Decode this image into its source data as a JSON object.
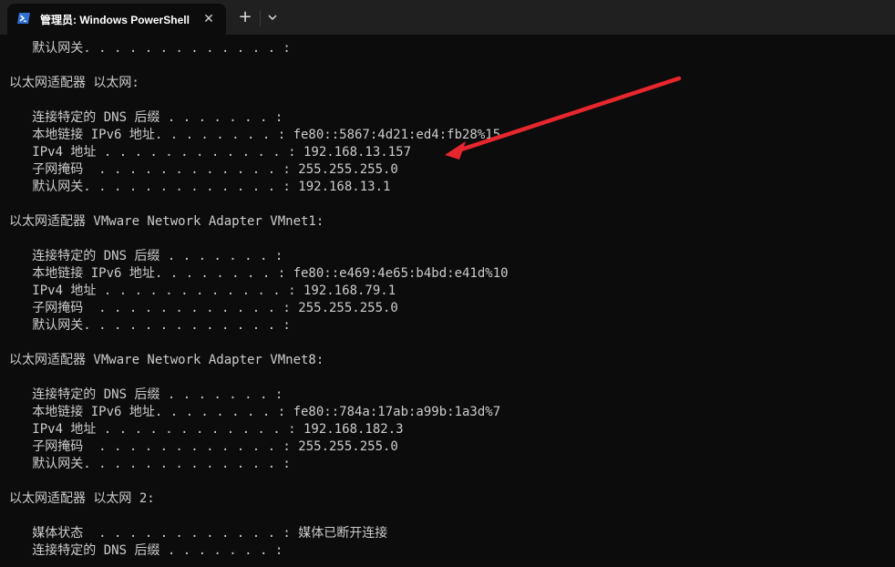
{
  "window": {
    "tab_title": "管理员: Windows PowerShell",
    "close_glyph": "✕",
    "new_tab_glyph": "+",
    "tab_icon": "powershell-icon",
    "dropdown_icon": "chevron-down-icon"
  },
  "terminal": {
    "lines": [
      "   默认网关. . . . . . . . . . . . . :",
      "",
      "以太网适配器 以太网:",
      "",
      "   连接特定的 DNS 后缀 . . . . . . . :",
      "   本地链接 IPv6 地址. . . . . . . . : fe80::5867:4d21:ed4:fb28%15",
      "   IPv4 地址 . . . . . . . . . . . . : 192.168.13.157",
      "   子网掩码  . . . . . . . . . . . . : 255.255.255.0",
      "   默认网关. . . . . . . . . . . . . : 192.168.13.1",
      "",
      "以太网适配器 VMware Network Adapter VMnet1:",
      "",
      "   连接特定的 DNS 后缀 . . . . . . . :",
      "   本地链接 IPv6 地址. . . . . . . . : fe80::e469:4e65:b4bd:e41d%10",
      "   IPv4 地址 . . . . . . . . . . . . : 192.168.79.1",
      "   子网掩码  . . . . . . . . . . . . : 255.255.255.0",
      "   默认网关. . . . . . . . . . . . . :",
      "",
      "以太网适配器 VMware Network Adapter VMnet8:",
      "",
      "   连接特定的 DNS 后缀 . . . . . . . :",
      "   本地链接 IPv6 地址. . . . . . . . : fe80::784a:17ab:a99b:1a3d%7",
      "   IPv4 地址 . . . . . . . . . . . . : 192.168.182.3",
      "   子网掩码  . . . . . . . . . . . . : 255.255.255.0",
      "   默认网关. . . . . . . . . . . . . :",
      "",
      "以太网适配器 以太网 2:",
      "",
      "   媒体状态  . . . . . . . . . . . . : 媒体已断开连接",
      "   连接特定的 DNS 后缀 . . . . . . . :"
    ]
  },
  "annotation": {
    "arrow_color": "#e8262d"
  }
}
